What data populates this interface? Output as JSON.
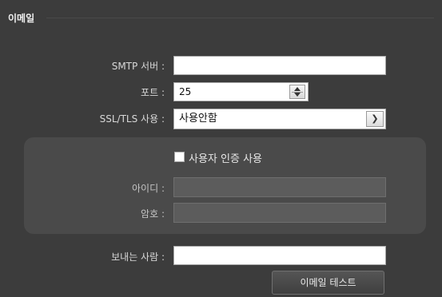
{
  "section": {
    "title": "이메일"
  },
  "smtp": {
    "label": "SMTP 서버 :",
    "value": ""
  },
  "port": {
    "label": "포트 :",
    "value": "25"
  },
  "ssl": {
    "label": "SSL/TLS 사용 :",
    "selected": "사용안함"
  },
  "auth": {
    "checkbox_label": "사용자 인증 사용",
    "checked": false,
    "id_label": "아이디 :",
    "id_value": "",
    "password_label": "암호 :",
    "password_value": ""
  },
  "sender": {
    "label": "보내는 사람 :",
    "value": ""
  },
  "test_button": {
    "label": "이메일 테스트"
  }
}
